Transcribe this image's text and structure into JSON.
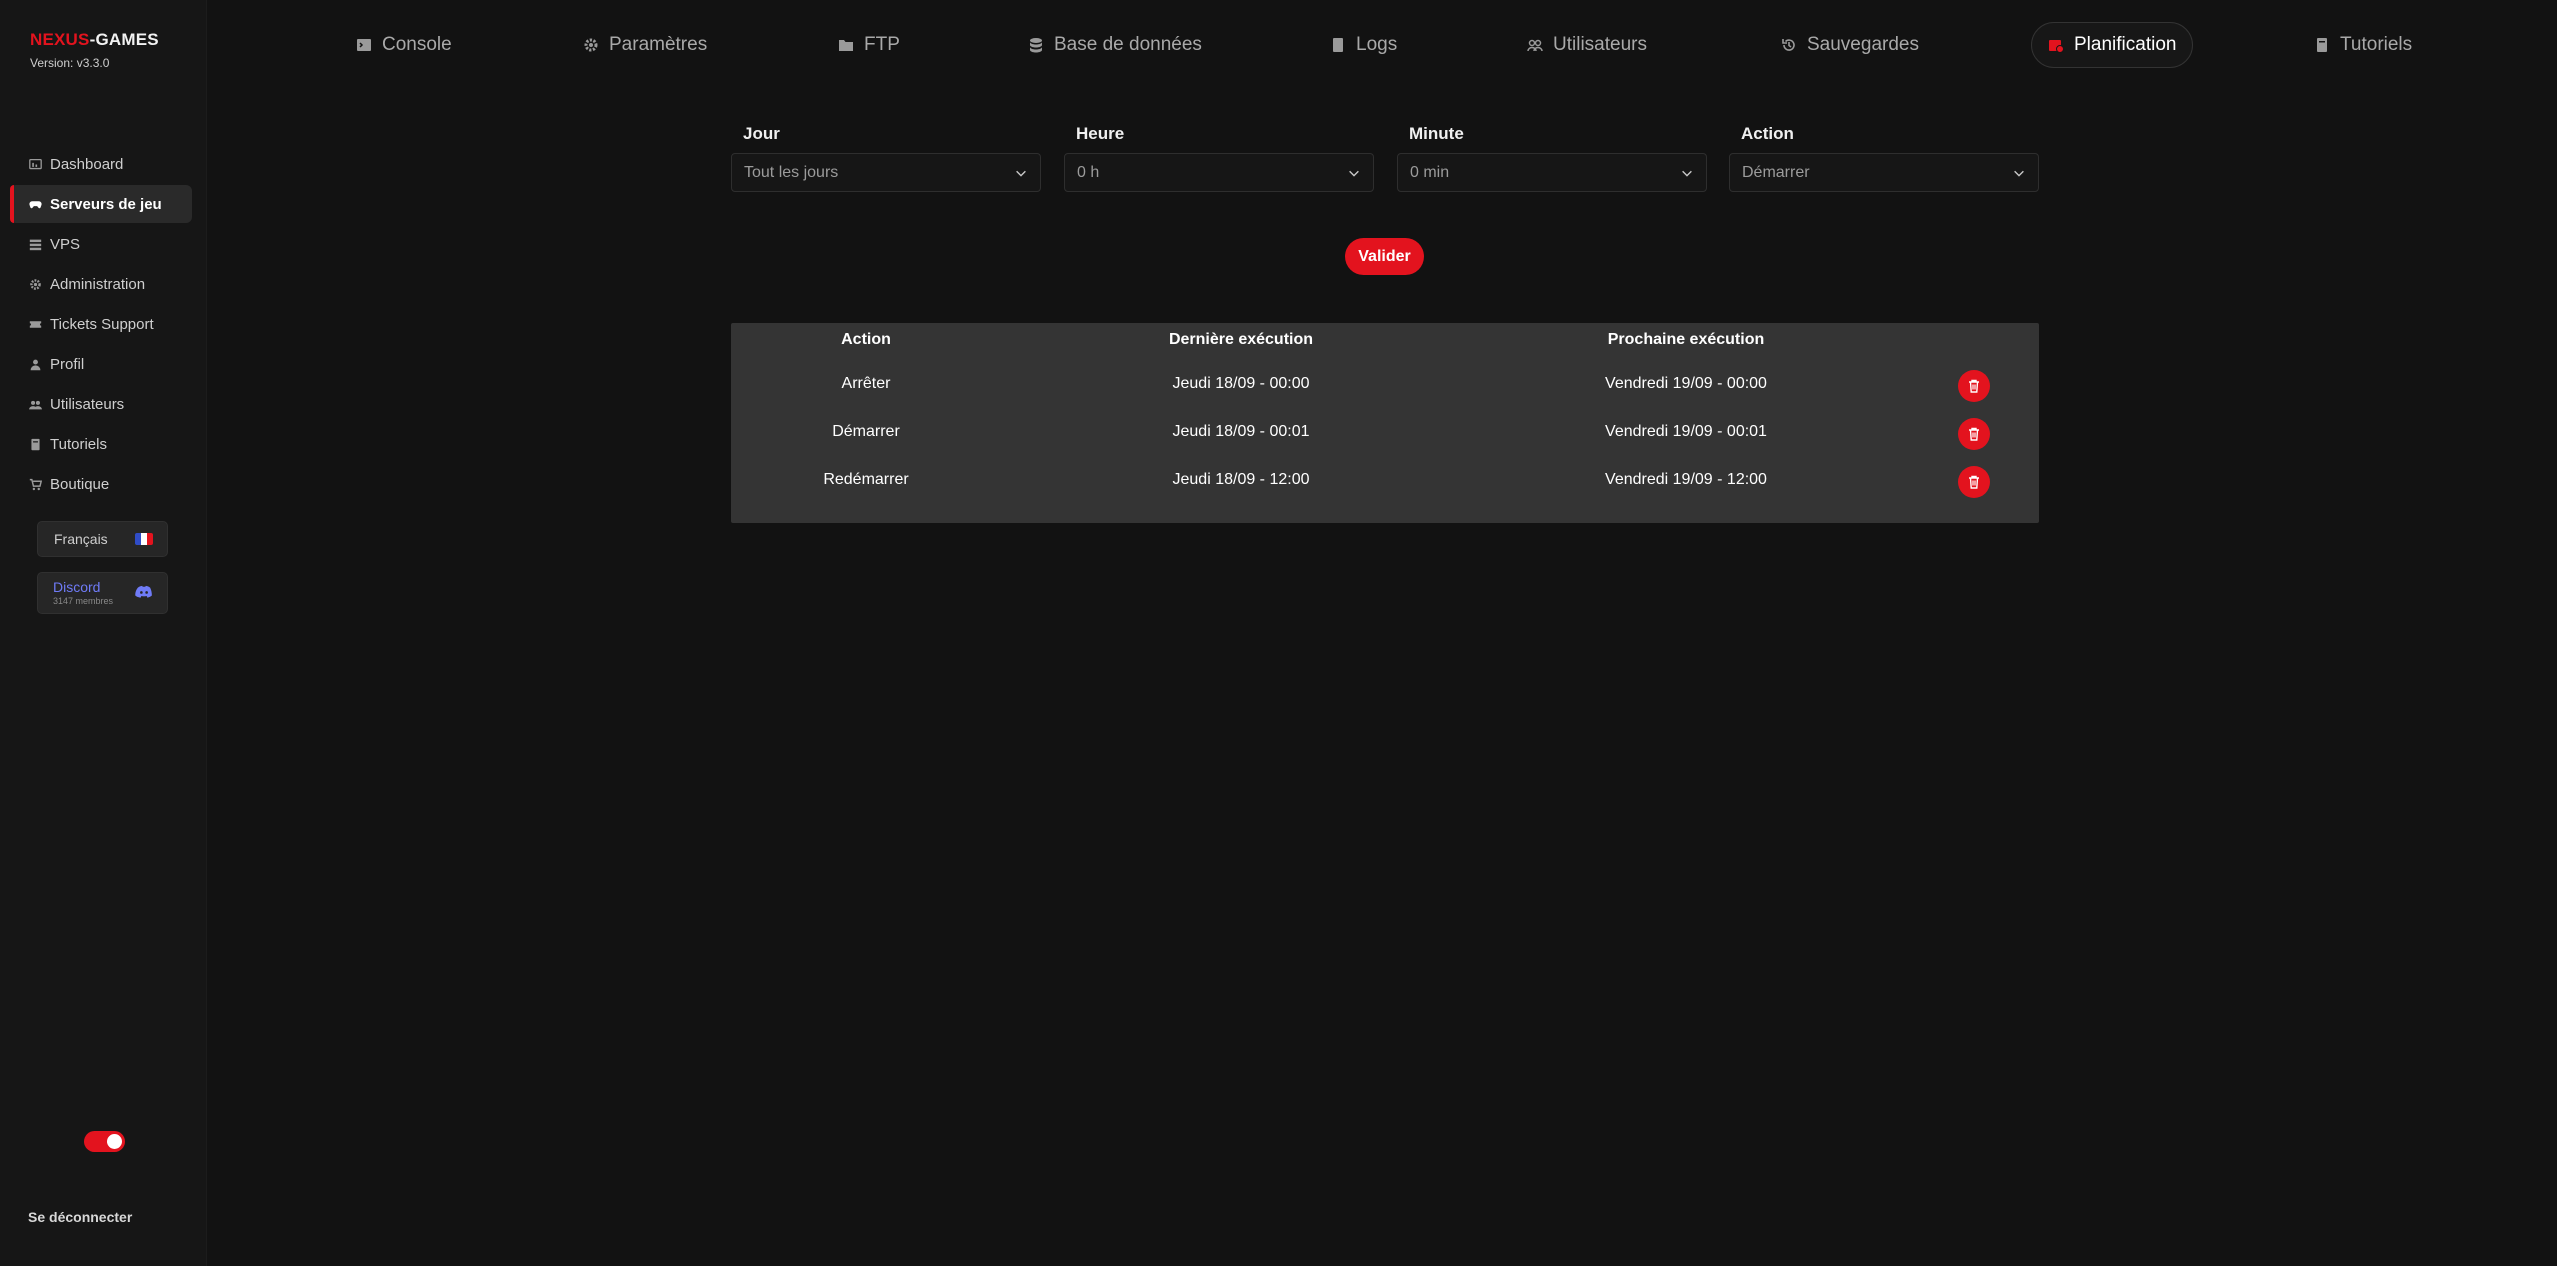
{
  "brand": {
    "title_red": "NEXUS",
    "title_white": "-GAMES",
    "version": "Version: v3.3.0"
  },
  "sidebar": {
    "items": [
      {
        "label": "Dashboard",
        "icon": "dashboard-icon",
        "active": false
      },
      {
        "label": "Serveurs de jeu",
        "icon": "gamepad-icon",
        "active": true
      },
      {
        "label": "VPS",
        "icon": "server-icon",
        "active": false
      },
      {
        "label": "Administration",
        "icon": "gear-icon",
        "active": false
      },
      {
        "label": "Tickets Support",
        "icon": "ticket-icon",
        "active": false
      },
      {
        "label": "Profil",
        "icon": "user-icon",
        "active": false
      },
      {
        "label": "Utilisateurs",
        "icon": "users-icon",
        "active": false
      },
      {
        "label": "Tutoriels",
        "icon": "book-icon",
        "active": false
      },
      {
        "label": "Boutique",
        "icon": "cart-icon",
        "active": false
      }
    ],
    "language": "Français",
    "discord": {
      "name": "Discord",
      "members": "3147 membres"
    },
    "logout": "Se déconnecter"
  },
  "tabs": [
    {
      "label": "Console",
      "icon": "terminal-icon"
    },
    {
      "label": "Paramètres",
      "icon": "gear-icon"
    },
    {
      "label": "FTP",
      "icon": "folder-icon"
    },
    {
      "label": "Base de données",
      "icon": "database-icon"
    },
    {
      "label": "Logs",
      "icon": "file-icon"
    },
    {
      "label": "Utilisateurs",
      "icon": "users-icon"
    },
    {
      "label": "Sauvegardes",
      "icon": "history-icon"
    },
    {
      "label": "Planification",
      "icon": "calendar-icon",
      "active": true
    },
    {
      "label": "Tutoriels",
      "icon": "book-icon"
    }
  ],
  "form": {
    "day": {
      "label": "Jour",
      "value": "Tout les jours"
    },
    "hour": {
      "label": "Heure",
      "value": "0 h"
    },
    "minute": {
      "label": "Minute",
      "value": "0 min"
    },
    "action": {
      "label": "Action",
      "value": "Démarrer"
    },
    "submit": "Valider"
  },
  "table": {
    "headers": [
      "Action",
      "Dernière exécution",
      "Prochaine exécution"
    ],
    "rows": [
      {
        "action": "Arrêter",
        "last": "Jeudi 18/09 - 00:00",
        "next": "Vendredi 19/09 - 00:00"
      },
      {
        "action": "Démarrer",
        "last": "Jeudi 18/09 - 00:01",
        "next": "Vendredi 19/09 - 00:01"
      },
      {
        "action": "Redémarrer",
        "last": "Jeudi 18/09 - 12:00",
        "next": "Vendredi 19/09 - 12:00"
      }
    ]
  },
  "colors": {
    "accent": "#e3131e",
    "discord": "#6f7bf7",
    "background": "#121212"
  }
}
